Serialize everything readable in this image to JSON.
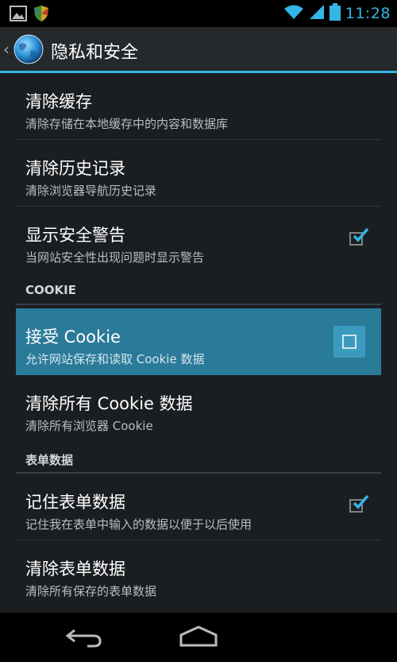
{
  "status": {
    "time": "11:28"
  },
  "header": {
    "title": "隐私和安全"
  },
  "items": [
    {
      "title": "清除缓存",
      "summary": "清除存储在本地缓存中的内容和数据库"
    },
    {
      "title": "清除历史记录",
      "summary": "清除浏览器导航历史记录"
    },
    {
      "title": "显示安全警告",
      "summary": "当网站安全性出现问题时显示警告",
      "checked": true
    }
  ],
  "cookie_section": {
    "label": "COOKIE"
  },
  "cookie_items": [
    {
      "title": "接受 Cookie",
      "summary": "允许网站保存和读取 Cookie 数据",
      "checked": false
    },
    {
      "title": "清除所有 Cookie 数据",
      "summary": "清除所有浏览器 Cookie"
    }
  ],
  "form_section": {
    "label": "表单数据"
  },
  "form_items": [
    {
      "title": "记住表单数据",
      "summary": "记住我在表单中输入的数据以便于以后使用",
      "checked": true
    },
    {
      "title": "清除表单数据",
      "summary": "清除所有保存的表单数据"
    }
  ],
  "colors": {
    "accent": "#33b5e5",
    "highlight": "#2a7a99",
    "background": "#1b1e21"
  },
  "icons": [
    "picture-icon",
    "shield-icon",
    "wifi-icon",
    "signal-icon",
    "battery-icon",
    "back-nav-icon",
    "home-nav-icon",
    "globe-logo-icon",
    "checkmark-icon"
  ]
}
